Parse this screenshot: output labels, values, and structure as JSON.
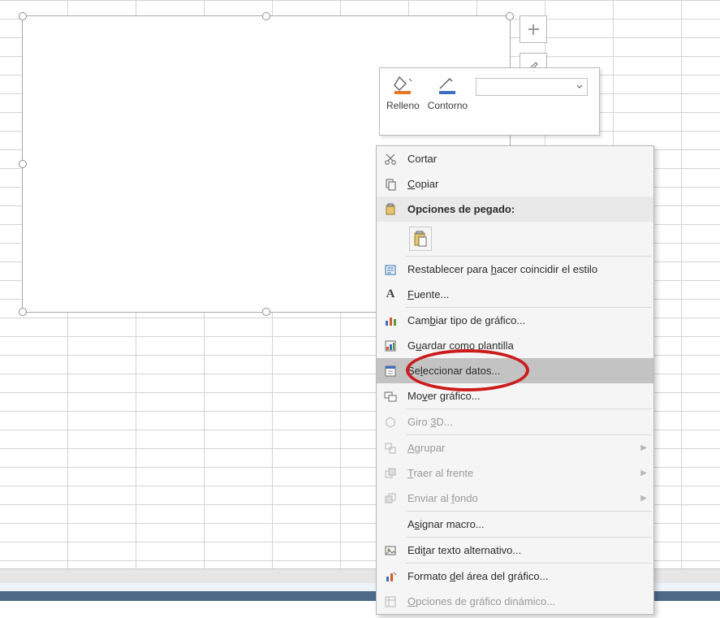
{
  "toolbar": {
    "fill_label": "Relleno",
    "outline_label": "Contorno"
  },
  "chart_buttons": {
    "add_element_symbol": "+",
    "brush_symbol": "✎"
  },
  "context_menu": {
    "cut": "Cortar",
    "copy": "Copiar",
    "paste_header": "Opciones de pegado:",
    "reset_style_pre": "Restablecer para ",
    "reset_style_under": "h",
    "reset_style_post": "acer coincidir el estilo",
    "font_under": "F",
    "font_post": "uente...",
    "change_pre": "Cam",
    "change_under": "b",
    "change_post": "iar tipo de gráfico...",
    "save_pre": "G",
    "save_under": "u",
    "save_post": "ardar como plantilla",
    "select_pre": "Se",
    "select_under": "l",
    "select_post": "eccionar datos...",
    "move_pre": "Mo",
    "move_under": "v",
    "move_post": "er gráfico...",
    "rotate_pre": "Giro ",
    "rotate_under": "3",
    "rotate_post": "D...",
    "group_under": "A",
    "group_post": "grupar",
    "bring_under": "T",
    "bring_post": "raer al frente",
    "send_pre": "Enviar al ",
    "send_under": "f",
    "send_post": "ondo",
    "assign_pre": "A",
    "assign_under": "s",
    "assign_post": "ignar macro...",
    "alt_pre": "Edi",
    "alt_under": "t",
    "alt_post": "ar texto alternativo...",
    "format_pre": "Formato ",
    "format_under": "d",
    "format_post": "el área del gráfico...",
    "dyn_under": "O",
    "dyn_post": "pciones de gráfico dinámico..."
  }
}
